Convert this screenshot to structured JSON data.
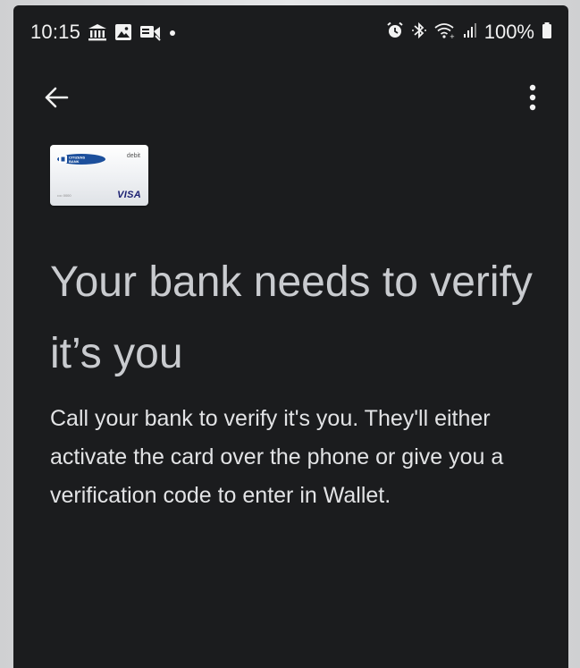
{
  "status_bar": {
    "time": "10:15",
    "battery": "100%",
    "left_icons": [
      "bank-icon",
      "image-icon",
      "voicemail-icon",
      "dot-icon"
    ],
    "right_icons": [
      "alarm-icon",
      "bluetooth-icon",
      "wifi-icon",
      "signal-icon",
      "battery-icon"
    ]
  },
  "app_bar": {
    "back_icon": "arrow-left-icon",
    "menu_icon": "more-vert-icon"
  },
  "card": {
    "issuer": "CITIZENS BANK",
    "type": "debit",
    "network": "VISA"
  },
  "content": {
    "headline": "Your bank needs to verify it’s you",
    "body": "Call your bank to verify it's you. They'll either activate the card over the phone or give you a verification code to enter in Wallet."
  },
  "colors": {
    "background": "#1b1c1e",
    "headline": "#c9cbcf",
    "body": "#e2e3e5",
    "card_network": "#1a1f71"
  }
}
